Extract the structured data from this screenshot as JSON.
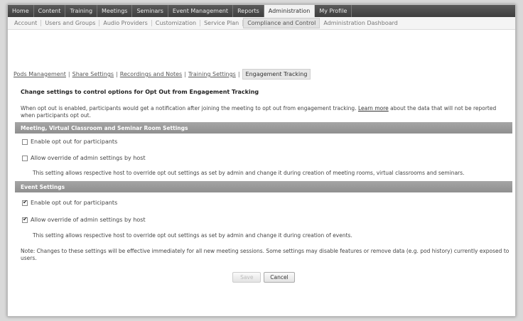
{
  "top_nav": [
    "Home",
    "Content",
    "Training",
    "Meetings",
    "Seminars",
    "Event Management",
    "Reports",
    "Administration",
    "My Profile"
  ],
  "top_nav_active": "Administration",
  "sub_nav": [
    "Account",
    "Users and Groups",
    "Audio Providers",
    "Customization",
    "Service Plan",
    "Compliance and Control",
    "Administration Dashboard"
  ],
  "sub_nav_active": "Compliance and Control",
  "pods_nav": {
    "links": [
      "Pods Management",
      "Share Settings",
      "Recordings and Notes",
      "Training Settings"
    ],
    "current": "Engagement Tracking"
  },
  "heading": "Change settings to control options for Opt Out from Engagement Tracking",
  "description": "When opt out is enabled, participants would get a notification after joining the meeting to opt out from engagement tracking.",
  "learn_more": "Learn more",
  "description_tail": "about the data that will not be reported when participants opt out.",
  "section_meeting": {
    "title": "Meeting, Virtual Classroom and Seminar Room Settings",
    "enable_label": "Enable opt out for participants",
    "enable_checked": false,
    "override_label": "Allow override of admin settings by host",
    "override_checked": false,
    "help": "This setting allows respective host to override opt out settings as set by admin and change it during creation of meeting rooms, virtual classrooms and seminars."
  },
  "section_event": {
    "title": "Event Settings",
    "enable_label": "Enable opt out for participants",
    "enable_checked": true,
    "override_label": "Allow override of admin settings by host",
    "override_checked": true,
    "help": "This setting allows respective host to override opt out settings as set by admin and change it during creation of events."
  },
  "note": "Note: Changes to these settings will be effective immediately for all new meeting sessions. Some settings may disable features or remove data (e.g. pod history) currently exposed to users.",
  "buttons": {
    "save": "Save",
    "cancel": "Cancel"
  }
}
